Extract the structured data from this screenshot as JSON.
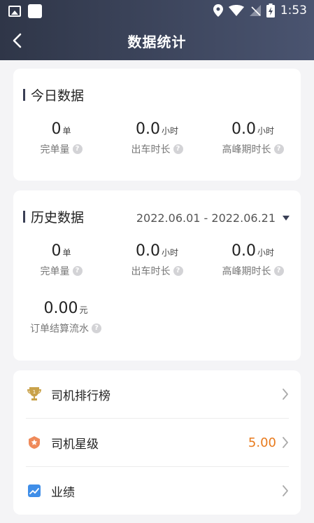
{
  "status_bar": {
    "time": "1:53"
  },
  "nav": {
    "title": "数据统计"
  },
  "today": {
    "title": "今日数据",
    "stats": [
      {
        "value": "0",
        "unit": "单",
        "label": "完单量"
      },
      {
        "value": "0.0",
        "unit": "小时",
        "label": "出车时长"
      },
      {
        "value": "0.0",
        "unit": "小时",
        "label": "高峰期时长"
      }
    ]
  },
  "history": {
    "title": "历史数据",
    "date_range": "2022.06.01 - 2022.06.21",
    "stats": [
      {
        "value": "0",
        "unit": "单",
        "label": "完单量"
      },
      {
        "value": "0.0",
        "unit": "小时",
        "label": "出车时长"
      },
      {
        "value": "0.0",
        "unit": "小时",
        "label": "高峰期时长"
      },
      {
        "value": "0.00",
        "unit": "元",
        "label": "订单结算流水"
      }
    ]
  },
  "menu": [
    {
      "label": "司机排行榜",
      "icon": "trophy-icon",
      "value": ""
    },
    {
      "label": "司机星级",
      "icon": "star-badge-icon",
      "value": "5.00"
    },
    {
      "label": "业绩",
      "icon": "chart-up-icon",
      "value": ""
    }
  ],
  "colors": {
    "header_start": "#2f3648",
    "header_end": "#4a5470",
    "accent": "#e87a1c",
    "trophy": "#c9a24a"
  }
}
